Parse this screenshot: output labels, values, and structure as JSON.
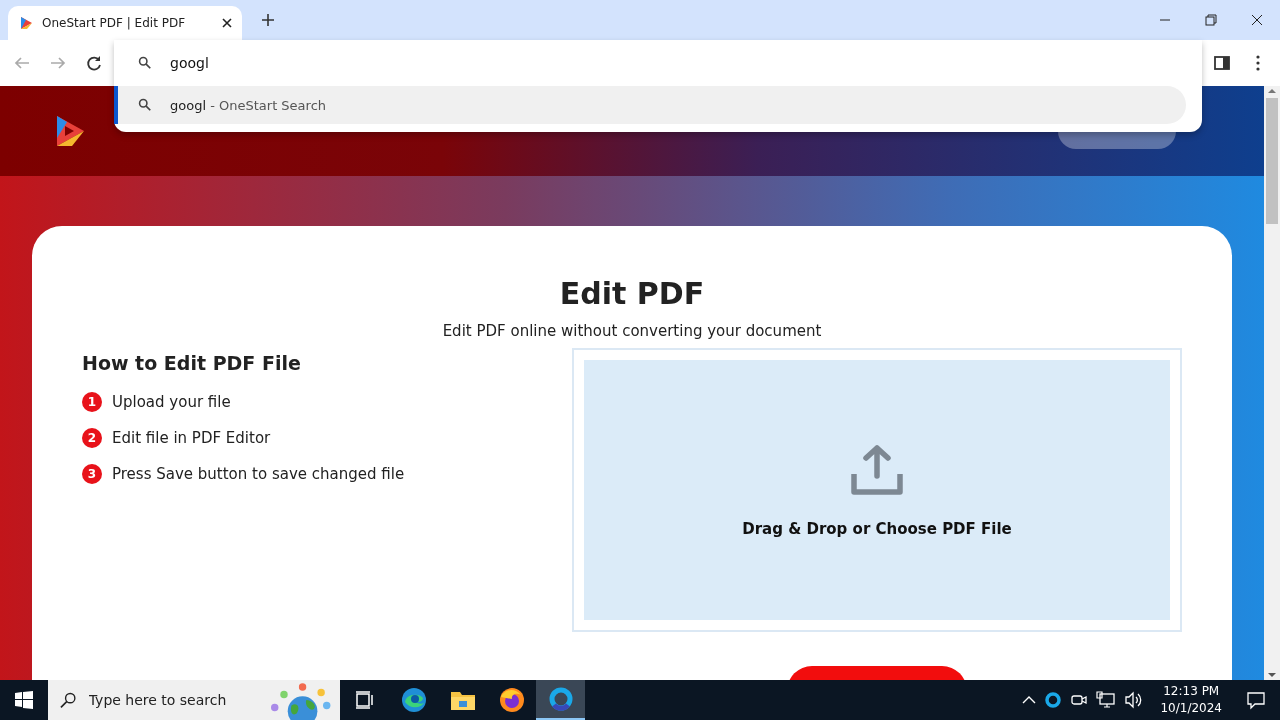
{
  "browser": {
    "tabs": [
      {
        "title": "OneStart PDF | Edit PDF",
        "selected": true
      }
    ],
    "omnibox": {
      "value": "googl",
      "suggestions": [
        {
          "text": "googl",
          "suffix": "- OneStart Search",
          "selected": true
        }
      ]
    }
  },
  "card": {
    "title": "Edit PDF",
    "subtitle": "Edit PDF online without converting your document",
    "howto": {
      "title": "How to Edit PDF File",
      "steps": [
        {
          "number": "1",
          "text": "Upload your file"
        },
        {
          "number": "2",
          "text": "Edit file in PDF Editor"
        },
        {
          "number": "3",
          "text": "Press Save button to save changed file"
        }
      ]
    },
    "dropzone": {
      "label": "Drag & Drop or Choose PDF File"
    }
  },
  "taskbar": {
    "search_placeholder": "Type here to search",
    "apps": [
      {
        "kind": "taskview",
        "selected": false
      },
      {
        "kind": "edge",
        "selected": false
      },
      {
        "kind": "folder",
        "selected": false
      },
      {
        "kind": "firefox",
        "selected": false
      },
      {
        "kind": "onestart",
        "selected": true
      }
    ],
    "time": "12:13 PM",
    "date": "10/1/2024"
  }
}
